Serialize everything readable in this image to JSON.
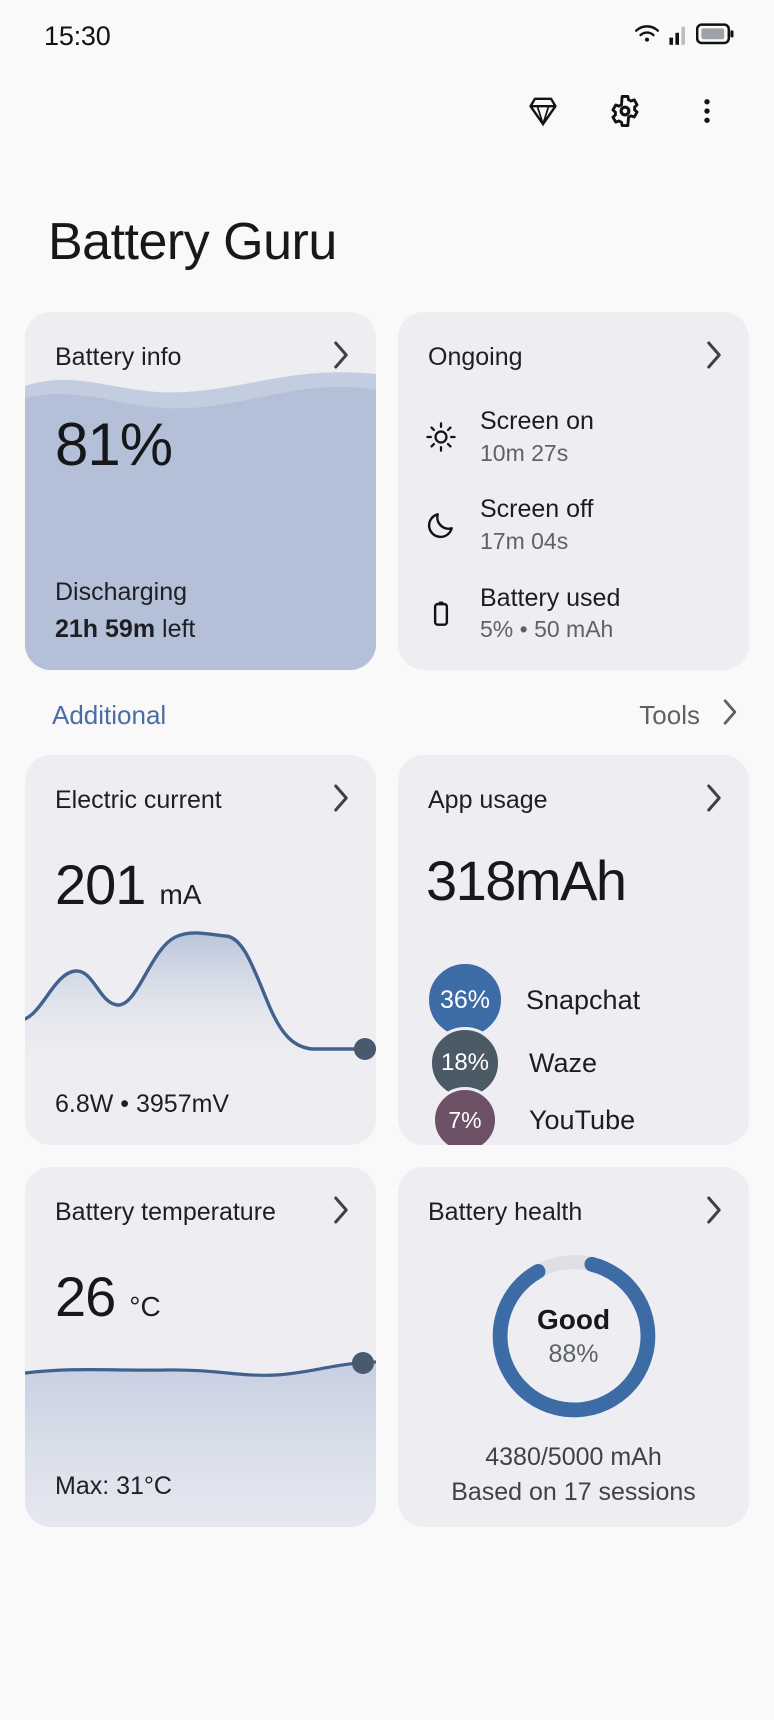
{
  "status_bar": {
    "time": "15:30",
    "icons": [
      "wifi-icon",
      "cellular-signal-icon",
      "battery-icon"
    ]
  },
  "app_bar": {
    "icons": [
      {
        "name": "premium-diamond-icon",
        "glyph": "diamond"
      },
      {
        "name": "settings-gear-icon",
        "glyph": "gear"
      },
      {
        "name": "overflow-menu-icon",
        "glyph": "dots"
      }
    ]
  },
  "page_title": "Battery Guru",
  "battery_info": {
    "title": "Battery info",
    "percent": "81%",
    "level": 81,
    "state": "Discharging",
    "time_left_bold": "21h 59m",
    "time_left_rest": " left",
    "fill_color": "#b4c0d8"
  },
  "ongoing": {
    "title": "Ongoing",
    "rows": [
      {
        "icon": "sun-icon",
        "label": "Screen on",
        "value": "10m 27s"
      },
      {
        "icon": "moon-icon",
        "label": "Screen off",
        "value": "17m 04s"
      },
      {
        "icon": "battery-vertical-icon",
        "label": "Battery used",
        "value": "5% • 50 mAh"
      }
    ]
  },
  "section_bar": {
    "left_tab": "Additional",
    "right_tab": "Tools",
    "left_color": "#4a6ea4",
    "right_color": "#5d6266"
  },
  "electric_current": {
    "title": "Electric current",
    "value": "201",
    "unit": "mA",
    "footer": "6.8W  •  3957mV",
    "line_color": "#41618f"
  },
  "app_usage": {
    "title": "App usage",
    "total": "318mAh",
    "apps": [
      {
        "percent": "36%",
        "name": "Snapchat",
        "color": "#3d6ba5",
        "size": 76
      },
      {
        "percent": "18%",
        "name": "Waze",
        "color": "#4c5a66",
        "size": 70
      },
      {
        "percent": "7%",
        "name": "YouTube",
        "color": "#6c5167",
        "size": 64
      }
    ]
  },
  "battery_temperature": {
    "title": "Battery temperature",
    "value": "26",
    "unit": "°C",
    "footer": "Max: 31°C",
    "line_color": "#41618f"
  },
  "battery_health": {
    "title": "Battery health",
    "status": "Good",
    "percent_label": "88%",
    "percent": 88,
    "capacity": "4380/5000 mAh",
    "sessions": "Based on 17 sessions",
    "arc_color": "#3d6ba5",
    "track_color": "#dfe0e6"
  },
  "chart_data": [
    {
      "type": "line",
      "title": "Electric current",
      "ylabel": "mA",
      "x": [
        0,
        1,
        2,
        3,
        4,
        5,
        6,
        7,
        8,
        9,
        10
      ],
      "values": [
        55,
        118,
        92,
        130,
        196,
        201,
        198,
        150,
        60,
        48,
        46
      ],
      "current_value": 201,
      "annotations": [
        "6.8W",
        "3957mV"
      ],
      "grid": false,
      "legend": "none"
    },
    {
      "type": "bar",
      "title": "App usage",
      "categories": [
        "Snapchat",
        "Waze",
        "YouTube"
      ],
      "values": [
        36,
        18,
        7
      ],
      "ylabel": "% of 318mAh",
      "total": "318mAh",
      "legend": "none"
    },
    {
      "type": "line",
      "title": "Battery temperature",
      "ylabel": "°C",
      "x": [
        0,
        1,
        2,
        3,
        4,
        5,
        6,
        7,
        8
      ],
      "values": [
        26,
        26,
        26,
        26,
        26,
        27,
        26,
        26,
        26
      ],
      "current_value": 26,
      "annotations": [
        "Max: 31°C"
      ],
      "grid": false,
      "legend": "none"
    },
    {
      "type": "pie",
      "title": "Battery health",
      "categories": [
        "Health",
        "Degraded"
      ],
      "values": [
        88,
        12
      ],
      "center_label": "Good",
      "center_sub": "88%",
      "annotations": [
        "4380/5000 mAh",
        "Based on 17 sessions"
      ]
    }
  ]
}
